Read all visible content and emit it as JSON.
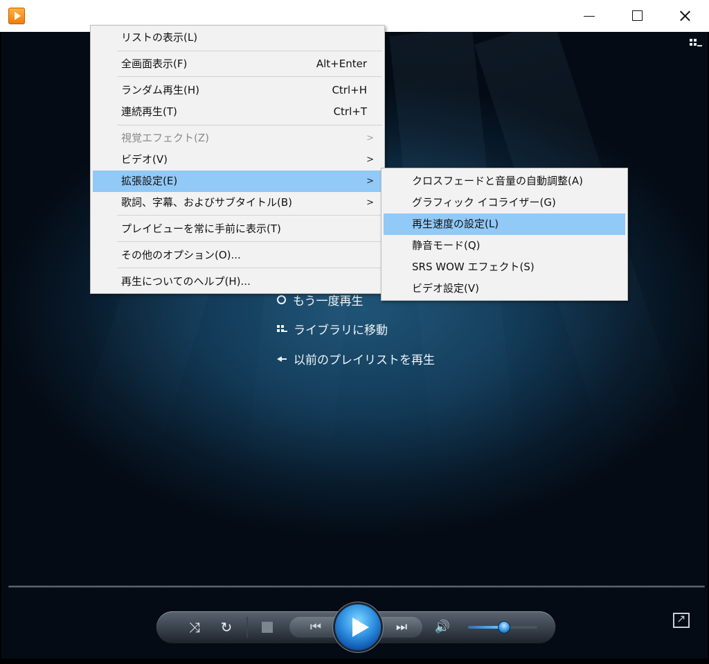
{
  "window": {
    "buttons": {
      "minimize": "minimize",
      "maximize": "maximize",
      "close": "close"
    }
  },
  "colors": {
    "menu_bg": "#f2f2f2",
    "highlight": "#91c9f7",
    "video_bg": "#123a57",
    "play_button": "#2e8fe0"
  },
  "main_menu": {
    "items": [
      {
        "label": "リストの表示(L)",
        "shortcut": ""
      },
      {
        "label": "全画面表示(F)",
        "shortcut": "Alt+Enter"
      },
      {
        "label": "ランダム再生(H)",
        "shortcut": "Ctrl+H"
      },
      {
        "label": "連続再生(T)",
        "shortcut": "Ctrl+T"
      },
      {
        "label": "視覚エフェクト(Z)",
        "shortcut": "",
        "disabled": true,
        "submenu": true
      },
      {
        "label": "ビデオ(V)",
        "shortcut": "",
        "submenu": true
      },
      {
        "label": "拡張設定(E)",
        "shortcut": "",
        "submenu": true,
        "highlighted": true
      },
      {
        "label": "歌詞、字幕、およびサブタイトル(B)",
        "shortcut": "",
        "submenu": true
      },
      {
        "label": "プレイビューを常に手前に表示(T)",
        "shortcut": ""
      },
      {
        "label": "その他のオプション(O)...",
        "shortcut": ""
      },
      {
        "label": "再生についてのヘルプ(H)...",
        "shortcut": ""
      }
    ]
  },
  "sub_menu": {
    "items": [
      {
        "label": "クロスフェードと音量の自動調整(A)"
      },
      {
        "label": "グラフィック イコライザー(G)"
      },
      {
        "label": "再生速度の設定(L)",
        "highlighted": true
      },
      {
        "label": "静音モード(Q)"
      },
      {
        "label": "SRS WOW エフェクト(S)"
      },
      {
        "label": "ビデオ設定(V)"
      }
    ]
  },
  "tasks": [
    {
      "label": "もう一度再生",
      "icon": "replay-icon"
    },
    {
      "label": "ライブラリに移動",
      "icon": "library-icon"
    },
    {
      "label": "以前のプレイリストを再生",
      "icon": "back-arrow-icon"
    }
  ],
  "controls": {
    "shuffle_glyph": "⤨",
    "repeat_glyph": "↻",
    "prev_glyph": "⏮",
    "next_glyph": "⏭",
    "volume_glyph": "🔊",
    "volume_level": 0.52
  }
}
